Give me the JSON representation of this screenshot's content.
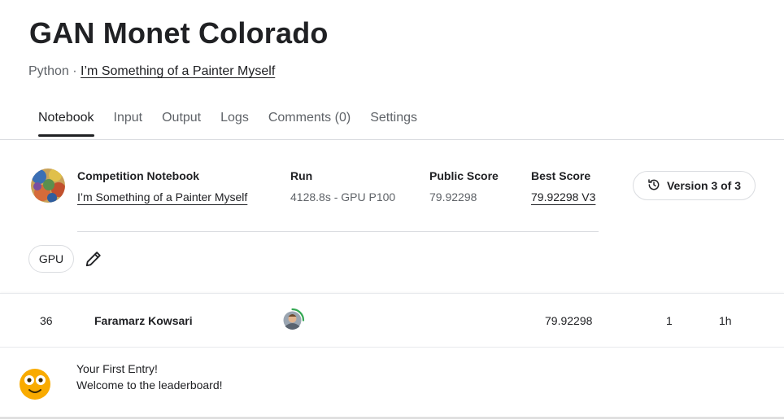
{
  "header": {
    "title": "GAN Monet Colorado",
    "language": "Python",
    "separator": "·",
    "competition_link": "I’m Something of a Painter Myself"
  },
  "tabs": [
    {
      "label": "Notebook",
      "active": true
    },
    {
      "label": "Input",
      "active": false
    },
    {
      "label": "Output",
      "active": false
    },
    {
      "label": "Logs",
      "active": false
    },
    {
      "label": "Comments (0)",
      "active": false
    },
    {
      "label": "Settings",
      "active": false
    }
  ],
  "info": {
    "competition_label": "Competition Notebook",
    "competition_value": "I’m Something of a Painter Myself",
    "run_label": "Run",
    "run_value": "4128.8s - GPU P100",
    "public_label": "Public Score",
    "public_value": "79.92298",
    "best_label": "Best Score",
    "best_value": "79.92298 V3",
    "version_label": "Version 3 of 3",
    "version_icon": "history-icon"
  },
  "accelerator": {
    "chip_label": "GPU",
    "edit_icon": "pencil-icon"
  },
  "leaderboard": {
    "rank": "36",
    "name": "Faramarz Kowsari",
    "score": "79.92298",
    "entries": "1",
    "last": "1h",
    "message_title": "Your First Entry!",
    "message_body": "Welcome to the leaderboard!"
  },
  "colors": {
    "text": "#202124",
    "muted": "#5f6368",
    "border": "#dadce0",
    "emoji": "#F9AB00",
    "progress_ring": "#34A853"
  }
}
